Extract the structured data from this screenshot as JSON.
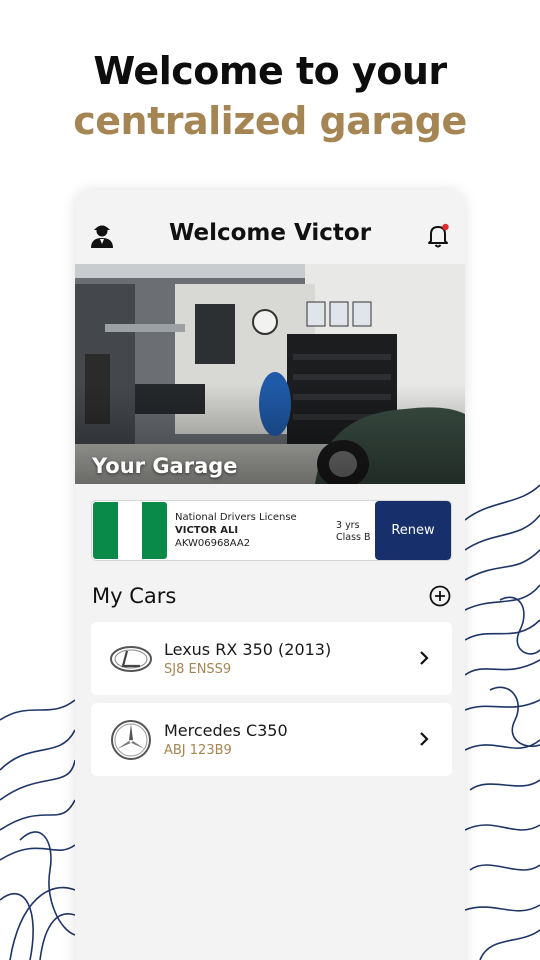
{
  "hero": {
    "line1": "Welcome to your",
    "line2": "centralized garage"
  },
  "header": {
    "title": "Welcome Victor",
    "user_icon": "user-icon",
    "bell_icon": "bell-icon"
  },
  "garage_banner": {
    "title": "Your Garage"
  },
  "license": {
    "type": "National Drivers License",
    "name": "VICTOR ALI",
    "number": "AKW06968AA2",
    "duration": "3 yrs",
    "class": "Class B",
    "renew_label": "Renew"
  },
  "cars_section": {
    "title": "My Cars",
    "add_icon": "plus-circle-icon"
  },
  "cars": [
    {
      "name": "Lexus RX 350 (2013)",
      "plate": "SJ8 ENSS9",
      "logo": "lexus-logo-icon"
    },
    {
      "name": "Mercedes C350",
      "plate": "ABJ 123B9",
      "logo": "mercedes-logo-icon"
    }
  ],
  "colors": {
    "gold": "#a48553",
    "navy": "#17306b",
    "flag_green": "#0a8a48",
    "topo_lines": "#1e3566"
  }
}
